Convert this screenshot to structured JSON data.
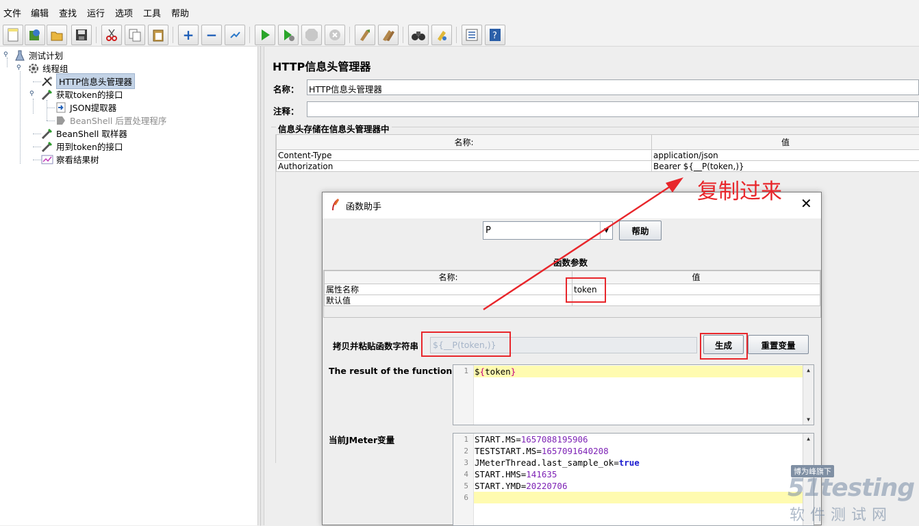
{
  "menubar": {
    "items": [
      "文件",
      "编辑",
      "查找",
      "运行",
      "选项",
      "工具",
      "帮助"
    ]
  },
  "toolbar": {
    "buttons": [
      "new-icon",
      "templates-icon",
      "open-icon",
      "save-icon",
      "cut-icon",
      "copy-icon",
      "paste-icon",
      "expand-icon",
      "collapse-icon",
      "toggle-icon",
      "start-icon",
      "start-no-pause-icon",
      "stop-icon",
      "shutdown-icon",
      "clear-icon",
      "clear-all-icon",
      "search-icon",
      "reset-search-icon",
      "function-helper-icon",
      "help-icon"
    ]
  },
  "tree": {
    "items": [
      {
        "label": "测试计划",
        "icon": "test-plan-icon"
      },
      {
        "label": "线程组",
        "icon": "thread-group-icon"
      },
      {
        "label": "HTTP信息头管理器",
        "icon": "config-element-icon",
        "selected": true
      },
      {
        "label": "获取token的接口",
        "icon": "sampler-icon"
      },
      {
        "label": "JSON提取器",
        "icon": "post-processor-icon"
      },
      {
        "label": "BeanShell 后置处理程序",
        "icon": "post-processor-disabled-icon",
        "disabled": true
      },
      {
        "label": "BeanShell 取样器",
        "icon": "sampler-icon"
      },
      {
        "label": "用到token的接口",
        "icon": "sampler-icon"
      },
      {
        "label": "察看结果树",
        "icon": "listener-icon"
      }
    ]
  },
  "panel": {
    "title": "HTTP信息头管理器",
    "name_label": "名称：",
    "name_value": "HTTP信息头管理器",
    "comment_label": "注释：",
    "comment_value": "",
    "group_title": "信息头存储在信息头管理器中",
    "table": {
      "headers": [
        "名称:",
        "值"
      ],
      "rows": [
        [
          "Content-Type",
          "application/json"
        ],
        [
          "Authorization",
          "Bearer ${__P(token,)}"
        ]
      ]
    }
  },
  "annotation": {
    "text": "复制过来",
    "color": "#e8262b"
  },
  "dialog": {
    "title": "函数助手",
    "function_select": "P",
    "help_button": "帮助",
    "params_title": "函数参数",
    "params_table": {
      "headers": [
        "名称:",
        "值"
      ],
      "rows": [
        [
          "属性名称",
          "token"
        ],
        [
          "默认值",
          ""
        ]
      ]
    },
    "copy_label": "拷贝并粘贴函数字符串",
    "function_string": "${__P(token,)}",
    "generate_button": "生成",
    "reset_button": "重置变量",
    "result_label": "The result of the function is",
    "result_lines": [
      "${token}"
    ],
    "vars_label": "当前JMeter变量",
    "vars_lines": [
      {
        "n": "1",
        "key": "START.MS",
        "val": "1657088195906"
      },
      {
        "n": "2",
        "key": "TESTSTART.MS",
        "val": "1657091640208"
      },
      {
        "n": "3",
        "key": "JMeterThread.last_sample_ok",
        "val": "true"
      },
      {
        "n": "4",
        "key": "START.HMS",
        "val": "141635"
      },
      {
        "n": "5",
        "key": "START.YMD",
        "val": "20220706"
      },
      {
        "n": "6",
        "key": "",
        "val": ""
      }
    ]
  },
  "watermark": {
    "badge": "博为峰旗下",
    "brand": "51testing",
    "sub": "软件测试网"
  },
  "colors": {
    "accent_red": "#e8262b",
    "selected_bg": "#c3d3e6",
    "highlight_line": "#fffbb0"
  }
}
